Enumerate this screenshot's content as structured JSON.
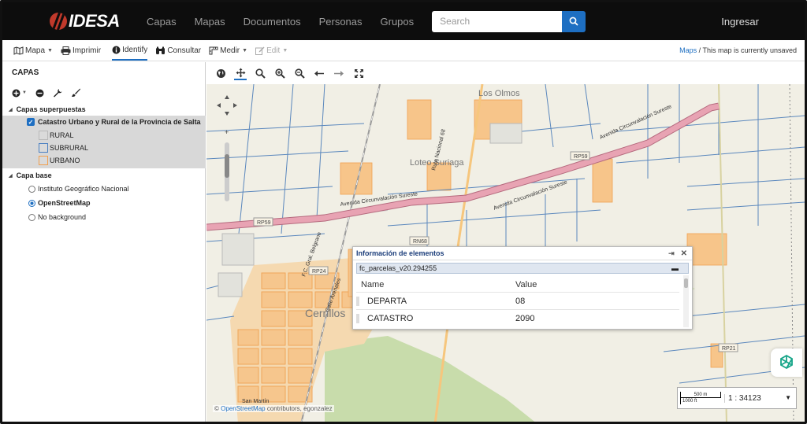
{
  "navbar": {
    "logo_text": "IDESA",
    "links": [
      "Capas",
      "Mapas",
      "Documentos",
      "Personas",
      "Grupos"
    ],
    "search_placeholder": "Search",
    "login": "Ingresar"
  },
  "toolbar": {
    "map": "Mapa",
    "print": "Imprimir",
    "identify": "Identify",
    "query": "Consultar",
    "measure": "Medir",
    "edit": "Edit",
    "breadcrumb_link": "Maps",
    "breadcrumb_text": "/ This map is currently unsaved"
  },
  "sidebar": {
    "title": "CAPAS",
    "overlay_group": "Capas superpuestas",
    "overlay_layer": "Catastro Urbano y Rural de la Provincia de Salta",
    "legend": [
      {
        "label": "RURAL",
        "color": "#b9b9b9"
      },
      {
        "label": "SUBRURAL",
        "color": "#4a7fc1"
      },
      {
        "label": "URBANO",
        "color": "#f0a050"
      }
    ],
    "base_group": "Capa base",
    "base_options": [
      {
        "label": "Instituto Geográfico Nacional",
        "selected": false
      },
      {
        "label": "OpenStreetMap",
        "selected": true
      },
      {
        "label": "No background",
        "selected": false
      }
    ]
  },
  "map": {
    "labels": {
      "olmos": "Los Olmos",
      "loteo": "Loteo Suriaga",
      "cerrillos": "Cerrillos",
      "avenida1": "Avenida Circunvalación Sureste",
      "avenida2": "Avenida Circunvalación Sureste",
      "avenida3": "Avenida Circunvalación Sureste",
      "rp59a": "RP59",
      "rp59b": "RP59",
      "rn68": "RN68",
      "rp24": "RP24",
      "rp21": "RP21",
      "ruta_nac": "Ruta Nacional 68",
      "fc": "F.C. Gral. Belgrano",
      "cerrillos_road": "Calle Arenales",
      "san_martin": "San Martín"
    },
    "attribution_link": "OpenStreetMap",
    "attribution_text": "contributors, egonzalez",
    "scale": {
      "metric": "500 m",
      "imperial": "1000 ft",
      "ratio": "1 : 34123"
    }
  },
  "popup": {
    "title": "Información de elementos",
    "feature": "fc_parcelas_v20.294255",
    "col_name": "Name",
    "col_value": "Value",
    "rows": [
      {
        "name": "DEPARTA",
        "value": "08"
      },
      {
        "name": "CATASTRO",
        "value": "2090"
      }
    ]
  },
  "colors": {
    "navbar_bg": "#0d0d0d",
    "accent": "#1e6fc2",
    "road_pink": "#e8a3b3",
    "urban_orange": "#f6b86a",
    "rural_blue": "#5a87bd"
  }
}
